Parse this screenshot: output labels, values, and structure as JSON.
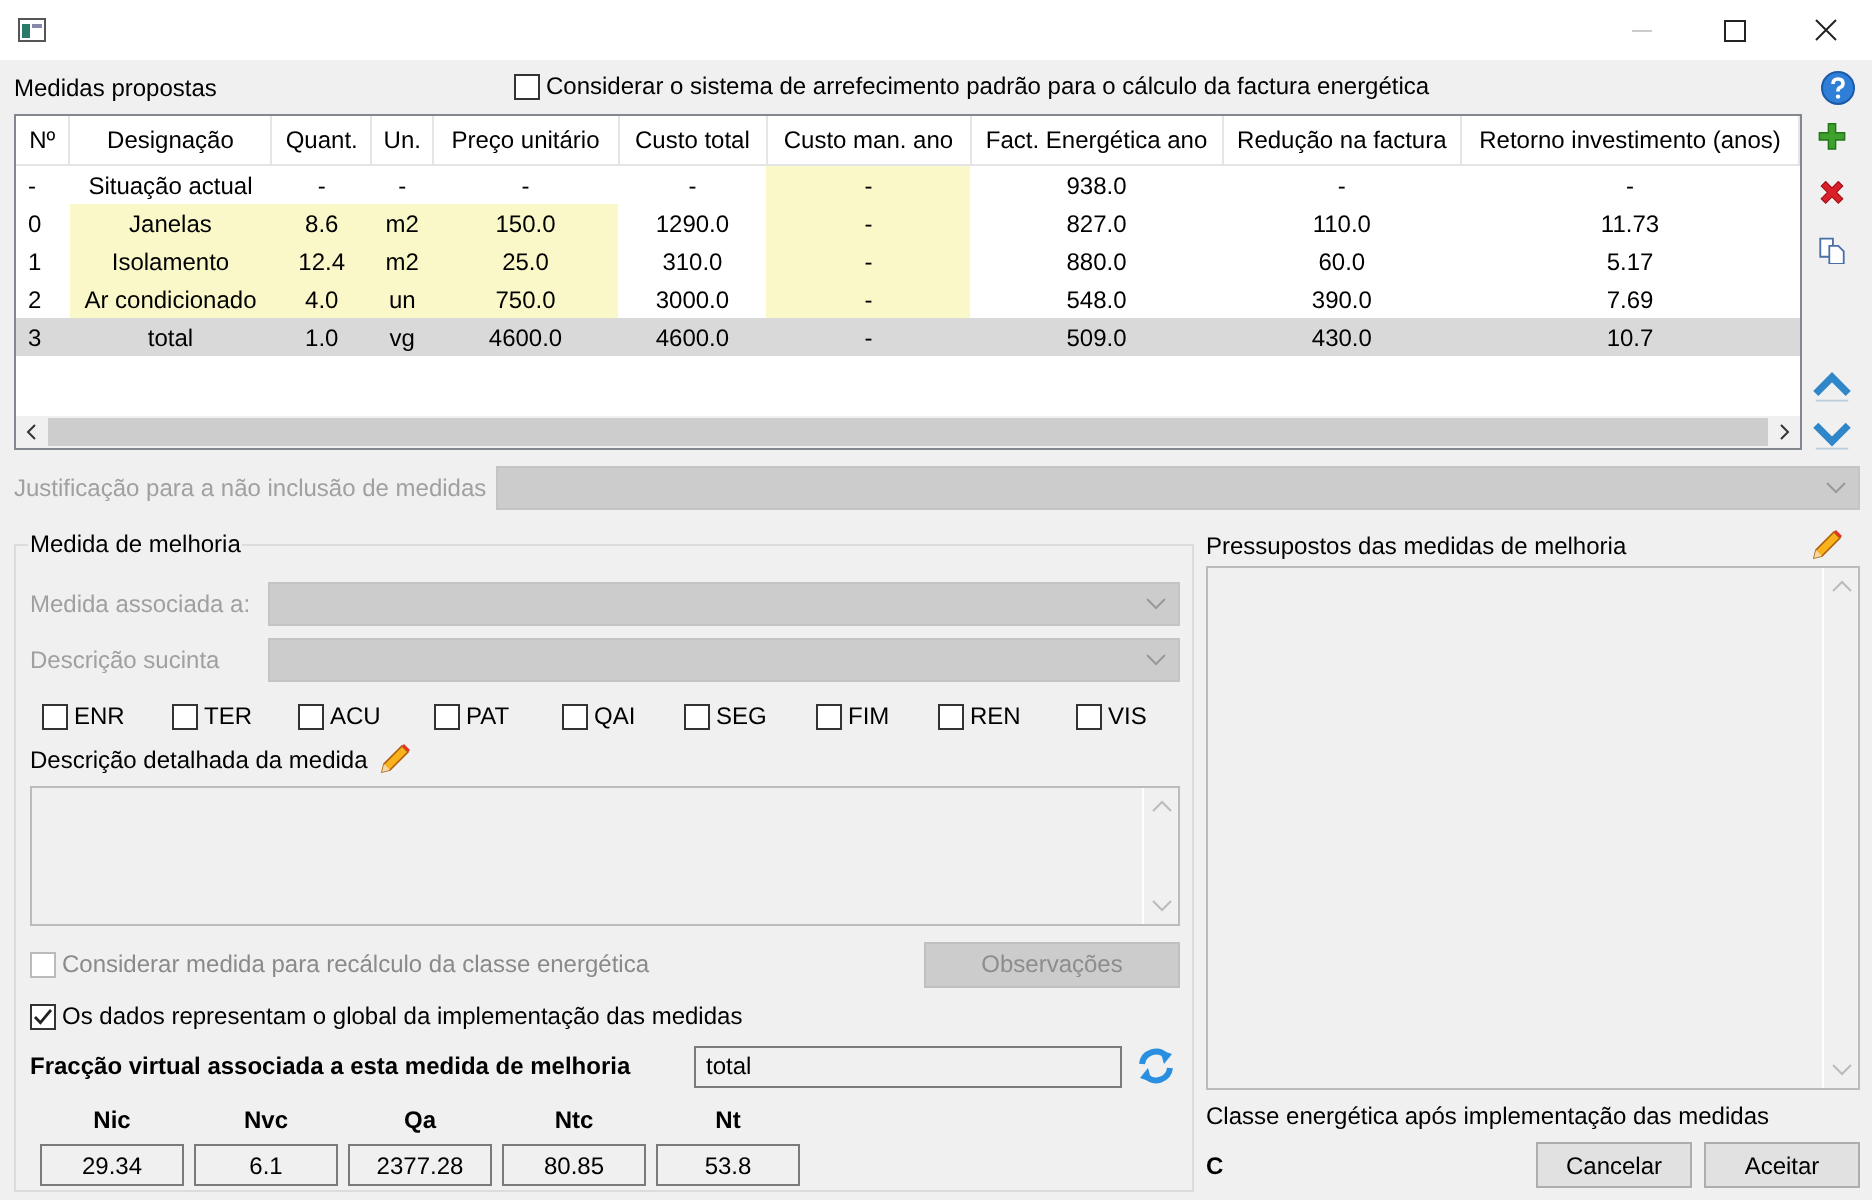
{
  "header": {
    "title": "Medidas propostas",
    "cooling_option": {
      "label": "Considerar o sistema de arrefecimento padrão para o cálculo da factura energética",
      "checked": false
    }
  },
  "table": {
    "columns": [
      "Nº",
      "Designação",
      "Quant.",
      "Un.",
      "Preço unitário",
      "Custo total",
      "Custo man. ano",
      "Fact. Energética ano",
      "Redução na factura",
      "Retorno investimento (anos)"
    ],
    "rows": [
      {
        "selected": false,
        "cells": [
          {
            "text": "-",
            "highlighted": false
          },
          {
            "text": "Situação actual",
            "highlighted": false
          },
          {
            "text": "-",
            "highlighted": false
          },
          {
            "text": "-",
            "highlighted": false
          },
          {
            "text": "-",
            "highlighted": false
          },
          {
            "text": "-",
            "highlighted": false
          },
          {
            "text": "-",
            "highlighted": true
          },
          {
            "text": "938.0",
            "highlighted": false
          },
          {
            "text": "-",
            "highlighted": false
          },
          {
            "text": "-",
            "highlighted": false
          }
        ]
      },
      {
        "selected": false,
        "cells": [
          {
            "text": "0",
            "highlighted": false
          },
          {
            "text": "Janelas",
            "highlighted": true
          },
          {
            "text": "8.6",
            "highlighted": true
          },
          {
            "text": "m2",
            "highlighted": true
          },
          {
            "text": "150.0",
            "highlighted": true
          },
          {
            "text": "1290.0",
            "highlighted": false
          },
          {
            "text": "-",
            "highlighted": true
          },
          {
            "text": "827.0",
            "highlighted": false
          },
          {
            "text": "110.0",
            "highlighted": false
          },
          {
            "text": "11.73",
            "highlighted": false
          }
        ]
      },
      {
        "selected": false,
        "cells": [
          {
            "text": "1",
            "highlighted": false
          },
          {
            "text": "Isolamento",
            "highlighted": true
          },
          {
            "text": "12.4",
            "highlighted": true
          },
          {
            "text": "m2",
            "highlighted": true
          },
          {
            "text": "25.0",
            "highlighted": true
          },
          {
            "text": "310.0",
            "highlighted": false
          },
          {
            "text": "-",
            "highlighted": true
          },
          {
            "text": "880.0",
            "highlighted": false
          },
          {
            "text": "60.0",
            "highlighted": false
          },
          {
            "text": "5.17",
            "highlighted": false
          }
        ]
      },
      {
        "selected": false,
        "cells": [
          {
            "text": "2",
            "highlighted": false
          },
          {
            "text": "Ar condicionado",
            "highlighted": true
          },
          {
            "text": "4.0",
            "highlighted": true
          },
          {
            "text": "un",
            "highlighted": true
          },
          {
            "text": "750.0",
            "highlighted": true
          },
          {
            "text": "3000.0",
            "highlighted": false
          },
          {
            "text": "-",
            "highlighted": true
          },
          {
            "text": "548.0",
            "highlighted": false
          },
          {
            "text": "390.0",
            "highlighted": false
          },
          {
            "text": "7.69",
            "highlighted": false
          }
        ]
      },
      {
        "selected": true,
        "cells": [
          {
            "text": "3",
            "highlighted": false
          },
          {
            "text": "total",
            "highlighted": false
          },
          {
            "text": "1.0",
            "highlighted": false
          },
          {
            "text": "vg",
            "highlighted": false
          },
          {
            "text": "4600.0",
            "highlighted": false
          },
          {
            "text": "4600.0",
            "highlighted": false
          },
          {
            "text": "-",
            "highlighted": false
          },
          {
            "text": "509.0",
            "highlighted": false
          },
          {
            "text": "430.0",
            "highlighted": false
          },
          {
            "text": "10.7",
            "highlighted": false
          }
        ]
      }
    ]
  },
  "justification": {
    "label": "Justificação para a não inclusão de medidas",
    "disabled": true
  },
  "measure": {
    "title": "Medida de melhoria",
    "associated": {
      "label": "Medida associada a:",
      "disabled": true
    },
    "summary": {
      "label": "Descrição sucinta",
      "disabled": true
    },
    "categories": [
      {
        "label": "ENR",
        "checked": false
      },
      {
        "label": "TER",
        "checked": false
      },
      {
        "label": "ACU",
        "checked": false
      },
      {
        "label": "PAT",
        "checked": false
      },
      {
        "label": "QAI",
        "checked": false
      },
      {
        "label": "SEG",
        "checked": false
      },
      {
        "label": "FIM",
        "checked": false
      },
      {
        "label": "REN",
        "checked": false
      },
      {
        "label": "VIS",
        "checked": false
      }
    ],
    "detail_label": "Descrição detalhada da medida",
    "recalc": {
      "label": "Considerar medida para recálculo da classe energética",
      "checked": false,
      "disabled": true
    },
    "observations": {
      "label": "Observações",
      "disabled": true
    },
    "global": {
      "label": "Os dados representam o global da implementação das medidas",
      "checked": true
    },
    "fraction": {
      "label": "Fracção virtual associada a esta medida de melhoria",
      "value": "total"
    },
    "indicators": [
      {
        "name": "Nic",
        "value": "29.34"
      },
      {
        "name": "Nvc",
        "value": "6.1"
      },
      {
        "name": "Qa",
        "value": "2377.28"
      },
      {
        "name": "Ntc",
        "value": "80.85"
      },
      {
        "name": "Nt",
        "value": "53.8"
      }
    ]
  },
  "assumptions": {
    "title": "Pressupostos das medidas de melhoria"
  },
  "energy_class": {
    "label": "Classe energética após implementação das medidas",
    "value": "C"
  },
  "buttons": [
    {
      "label": "Cancelar"
    },
    {
      "label": "Aceitar"
    }
  ]
}
